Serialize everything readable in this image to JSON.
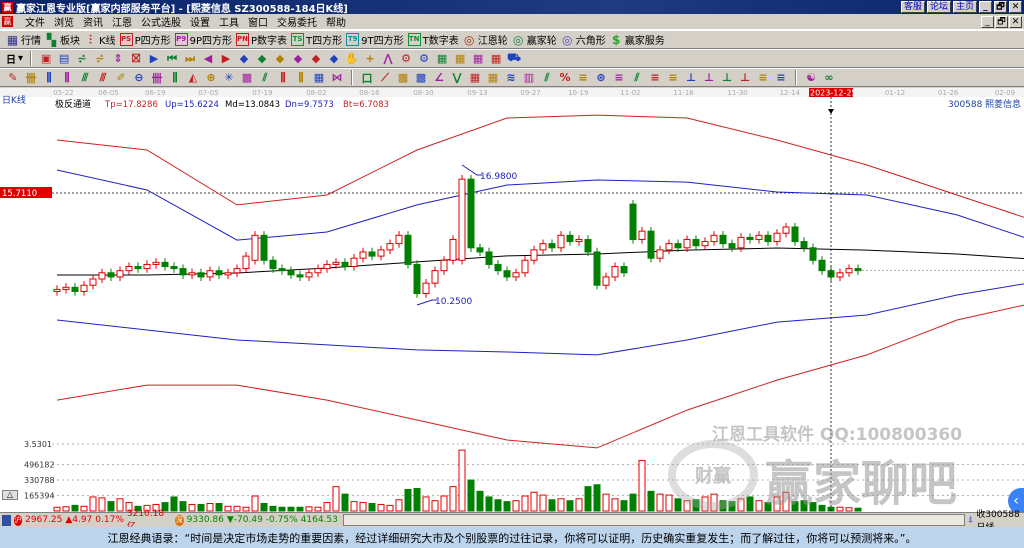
{
  "window": {
    "title": "赢家江恩专业版[赢家内部服务平台] - [熙菱信息   SZ300588-184日K线]",
    "links": [
      "客服",
      "论坛",
      "主页"
    ],
    "controls": [
      "_",
      "🗗",
      "✕"
    ]
  },
  "menu": [
    "文件",
    "浏览",
    "资讯",
    "江恩",
    "公式选股",
    "设置",
    "工具",
    "窗口",
    "交易委托",
    "帮助"
  ],
  "toolbar1": [
    {
      "icon": "quote-icon",
      "glyph": "▦",
      "color": "#303090",
      "label": "行情"
    },
    {
      "icon": "sector-icon",
      "glyph": "▚",
      "color": "#108030",
      "label": "板块"
    },
    {
      "icon": "kline-icon",
      "glyph": "⫶",
      "color": "#c02020",
      "label": "K线"
    },
    {
      "icon": "p-square-icon",
      "glyph": "PS",
      "color": "#c02020",
      "label": "P四方形"
    },
    {
      "icon": "9p-square-icon",
      "glyph": "P9",
      "color": "#a020a0",
      "label": "9P四方形"
    },
    {
      "icon": "p-number-icon",
      "glyph": "PN",
      "color": "#c02020",
      "label": "P数字表"
    },
    {
      "icon": "t-square-icon",
      "glyph": "TS",
      "color": "#109030",
      "label": "T四方形"
    },
    {
      "icon": "9t-square-icon",
      "glyph": "T9",
      "color": "#1090a0",
      "label": "9T四方形"
    },
    {
      "icon": "t-number-icon",
      "glyph": "TN",
      "color": "#109030",
      "label": "T数字表"
    },
    {
      "icon": "gann-wheel-icon",
      "glyph": "◎",
      "color": "#a03010",
      "label": "江恩轮"
    },
    {
      "icon": "winner-wheel-icon",
      "glyph": "◎",
      "color": "#208040",
      "label": "赢家轮"
    },
    {
      "icon": "hexagon-icon",
      "glyph": "◎",
      "color": "#5050c0",
      "label": "六角形"
    },
    {
      "icon": "service-icon",
      "glyph": "$",
      "color": "#30a030",
      "label": "赢家服务"
    }
  ],
  "toolbar2": {
    "period": "日",
    "glyphs": [
      "▣",
      "▤",
      "⩫",
      "⩫",
      "⇕",
      "⛝",
      "▶",
      "⏮",
      "⏭",
      "◀",
      "▶",
      "◆",
      "◆",
      "◆",
      "◆",
      "◆",
      "◆",
      "✋",
      "+",
      "⋀",
      "⚙",
      "⚙",
      "▦",
      "▦",
      "▦",
      "▦",
      "⛟"
    ]
  },
  "toolbar3": {
    "glyphs": [
      "✎",
      "卌",
      "⫼",
      "⫼",
      "⫻",
      "⫻",
      "✐",
      "⊖",
      "卌",
      "⫼",
      "◭",
      "⊕",
      "✳",
      "▩",
      "⫽",
      "⫼",
      "⫼",
      "▦",
      "⋈",
      "口",
      "⟋",
      "▩",
      "▩",
      "∠",
      "⋁",
      "▦",
      "▦",
      "≋",
      "▥",
      "⫽",
      "%",
      "≡",
      "⊛",
      "≡",
      "⫽",
      "≡",
      "≡",
      "⊥",
      "⊥",
      "⊥",
      "⊥",
      "≡",
      "≡",
      "☯",
      "∞"
    ]
  },
  "chart_header": {
    "period_label": "日K线",
    "indicator": "极反通道",
    "tp": "Tp=17.8286",
    "up": "Up=15.6224",
    "md": "Md=13.0843",
    "dn": "Dn=9.7573",
    "bt": "Bt=6.7083",
    "code": "300588",
    "name": "熙菱信息",
    "current_price_tag": "15.7110",
    "cursor_date": "2023-12-25"
  },
  "watermark": {
    "line1": "江恩工具软件  QQ:100800360",
    "brand": "赢家聊吧",
    "seal": "财赢"
  },
  "chart_data": {
    "type": "candlestick",
    "title": "熙菱信息 300588 日K线 极反通道",
    "price_range": [
      3.5301,
      20.1
    ],
    "annotations": [
      {
        "label": "16.9800",
        "value": 16.98,
        "idx": 45
      },
      {
        "label": "10.2500",
        "value": 10.25,
        "idx": 40
      }
    ],
    "date_ticks": [
      {
        "label": "05-22",
        "idx": 0.7
      },
      {
        "label": "06-05",
        "idx": 5.7
      },
      {
        "label": "06-19",
        "idx": 10.9
      },
      {
        "label": "07-05",
        "idx": 16.8
      },
      {
        "label": "07-19",
        "idx": 22.8
      },
      {
        "label": "08-02",
        "idx": 28.8
      },
      {
        "label": "08-16",
        "idx": 34.7
      },
      {
        "label": "08-30",
        "idx": 40.7
      },
      {
        "label": "09-13",
        "idx": 46.7
      },
      {
        "label": "09-27",
        "idx": 52.6
      },
      {
        "label": "10-19",
        "idx": 57.9
      },
      {
        "label": "11-02",
        "idx": 63.7
      },
      {
        "label": "11-16",
        "idx": 69.6
      },
      {
        "label": "11-30",
        "idx": 75.6
      },
      {
        "label": "12-14",
        "idx": 81.4
      },
      {
        "label": "01-12",
        "idx": 93.1
      },
      {
        "label": "01-26",
        "idx": 99
      },
      {
        "label": "02-09",
        "idx": 105.3
      }
    ],
    "cursor_idx": 86,
    "closes": [
      11.0,
      11.1,
      10.9,
      11.2,
      11.5,
      11.8,
      11.6,
      11.9,
      12.1,
      12.0,
      12.2,
      12.3,
      12.1,
      12.0,
      11.7,
      11.8,
      11.6,
      11.9,
      11.7,
      11.8,
      12.0,
      12.6,
      13.6,
      12.4,
      12.0,
      11.9,
      11.7,
      11.6,
      11.8,
      12.0,
      12.2,
      12.3,
      12.1,
      12.5,
      12.8,
      12.6,
      12.9,
      13.2,
      13.6,
      12.2,
      10.8,
      11.3,
      11.9,
      12.4,
      13.4,
      16.3,
      13.0,
      12.8,
      12.2,
      11.9,
      11.6,
      11.8,
      12.4,
      12.9,
      13.2,
      13.0,
      13.6,
      13.3,
      13.4,
      12.8,
      11.2,
      11.6,
      12.1,
      11.8,
      13.4,
      13.8,
      12.5,
      12.9,
      13.2,
      13.0,
      13.4,
      13.1,
      13.3,
      13.6,
      13.2,
      13.0,
      13.5,
      13.4,
      13.6,
      13.3,
      13.7,
      14.0,
      13.3,
      13.0,
      12.4,
      11.9,
      11.6,
      11.8,
      12.0,
      11.9
    ],
    "opens_override": {
      "64": 15.1,
      "45": 12.4,
      "22": 12.4
    },
    "volume": {
      "ticks": [
        "165394",
        "330788",
        "496182"
      ],
      "tick_values": [
        165394,
        330788,
        496182
      ],
      "top_label": "3.5301",
      "values": [
        40000,
        45000,
        60000,
        50000,
        150000,
        140000,
        100000,
        130000,
        90000,
        50000,
        60000,
        70000,
        90000,
        150000,
        100000,
        70000,
        70000,
        80000,
        80000,
        50000,
        50000,
        40000,
        160000,
        80000,
        50000,
        40000,
        40000,
        40000,
        45000,
        40000,
        90000,
        260000,
        180000,
        100000,
        90000,
        80000,
        70000,
        60000,
        120000,
        230000,
        240000,
        150000,
        110000,
        160000,
        260000,
        650000,
        330000,
        210000,
        150000,
        120000,
        100000,
        110000,
        160000,
        200000,
        170000,
        120000,
        130000,
        110000,
        130000,
        260000,
        280000,
        180000,
        130000,
        110000,
        180000,
        540000,
        210000,
        180000,
        170000,
        130000,
        110000,
        120000,
        150000,
        180000,
        110000,
        100000,
        130000,
        150000,
        110000,
        90000,
        150000,
        200000,
        100000,
        110000,
        90000,
        60000,
        40000,
        40000,
        35000,
        30000
      ]
    },
    "series": [
      {
        "name": "Tp",
        "color": "#d02020",
        "idx_step": 10,
        "values": [
          18.18,
          17.7,
          15.06,
          15.54,
          17.7,
          19.24,
          19.38,
          19.24,
          18.18,
          16.98,
          15.54,
          14.1
        ]
      },
      {
        "name": "Up",
        "color": "#2020c0",
        "idx_step": 10,
        "values": [
          16.74,
          15.78,
          13.37,
          13.76,
          15.06,
          16.02,
          16.26,
          16.16,
          15.68,
          15.54,
          14.58,
          13.13
        ]
      },
      {
        "name": "Md",
        "color": "#000000",
        "idx_step": 10,
        "values": [
          11.69,
          11.69,
          11.79,
          12.03,
          12.32,
          12.61,
          12.7,
          12.89,
          12.99,
          12.89,
          12.7,
          12.41
        ]
      },
      {
        "name": "Dn",
        "color": "#2020c0",
        "idx_step": 10,
        "values": [
          9.53,
          9.05,
          8.57,
          8.33,
          8.09,
          7.99,
          7.85,
          8.57,
          9.43,
          9.77,
          10.73,
          11.45
        ]
      },
      {
        "name": "Bt",
        "color": "#d02020",
        "idx_step": 10,
        "values": [
          5.68,
          6.4,
          6.4,
          5.68,
          4.72,
          3.76,
          3.38,
          5.2,
          6.64,
          7.85,
          9.53,
          10.49
        ]
      }
    ]
  },
  "status": {
    "sh_badge": "沪",
    "sh_index": "2967.25",
    "sh_change": "▲4.97",
    "sh_pct": "0.17%",
    "sh_amount": "3210.18亿",
    "sz_badge": "深",
    "sz_index": "9330.86",
    "sz_change": "▼-70.49",
    "sz_pct": "-0.75%",
    "sz_amount": "4164.53",
    "right_label": "收300588日线"
  },
  "footer": {
    "quote": "江恩经典语录：“时间是决定市场走势的重要因素，经过详细研究大市及个别股票的过往记录，你将可以证明，历史确实重复发生；而了解过往，你将可以预测将来。”。"
  }
}
